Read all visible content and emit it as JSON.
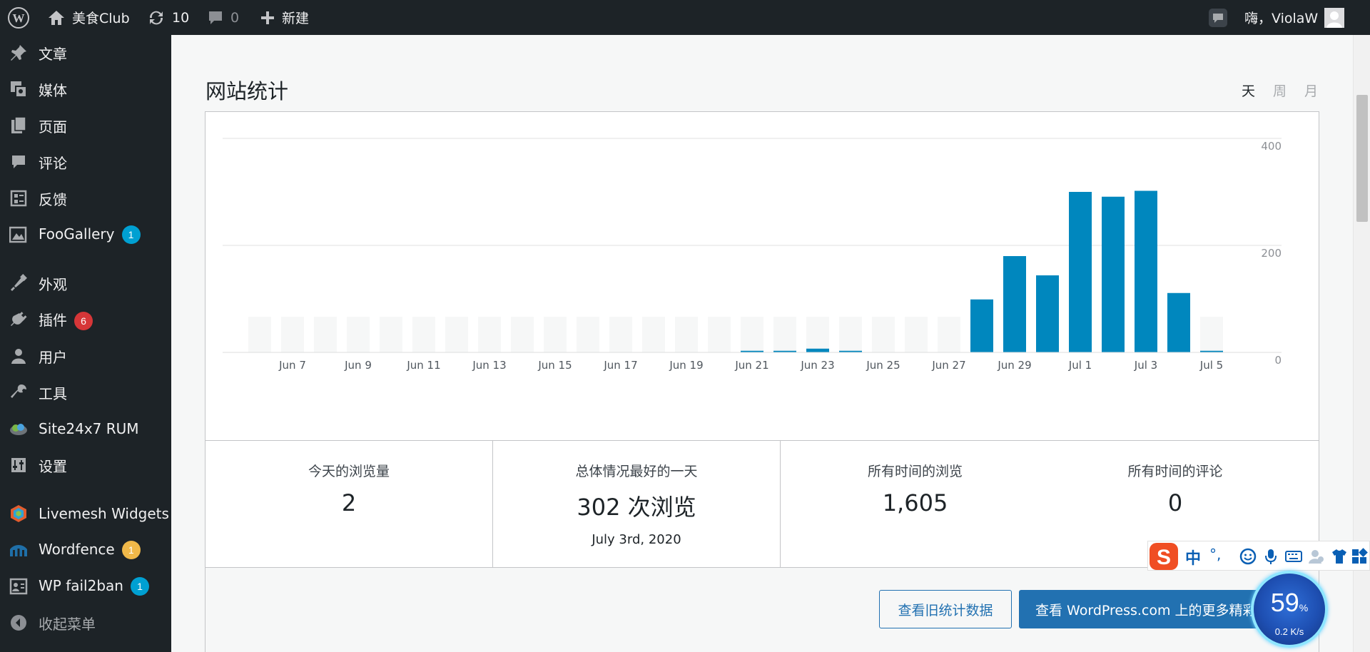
{
  "admin_bar": {
    "site_name": "美食Club",
    "updates_count": "10",
    "comments_count": "0",
    "new_label": "新建",
    "greeting": "嗨，ViolaW"
  },
  "sidebar": {
    "items": [
      {
        "label": "文章",
        "icon": "pushpin-icon"
      },
      {
        "label": "媒体",
        "icon": "media-icon"
      },
      {
        "label": "页面",
        "icon": "pages-icon"
      },
      {
        "label": "评论",
        "icon": "comment-icon"
      },
      {
        "label": "反馈",
        "icon": "feedback-icon"
      },
      {
        "label": "FooGallery",
        "icon": "gallery-icon",
        "badge": "1"
      },
      {
        "label": "外观",
        "icon": "appearance-icon"
      },
      {
        "label": "插件",
        "icon": "plugins-icon",
        "badge": "6"
      },
      {
        "label": "用户",
        "icon": "user-icon"
      },
      {
        "label": "工具",
        "icon": "tools-icon"
      },
      {
        "label": "Site24x7 RUM",
        "icon": "site24x7-icon"
      },
      {
        "label": "设置",
        "icon": "settings-icon"
      },
      {
        "label": "Livemesh Widgets",
        "icon": "livemesh-icon"
      },
      {
        "label": "Wordfence",
        "icon": "wordfence-icon",
        "badge": "1"
      },
      {
        "label": "WP fail2ban",
        "icon": "fail2ban-icon",
        "badge": "1"
      },
      {
        "label": "收起菜单",
        "icon": "collapse-icon"
      }
    ],
    "badge_colors": {
      "blue": "#00a0d2",
      "red": "#d63638",
      "orange": "#f0b849"
    }
  },
  "stats": {
    "title": "网站统计",
    "periods": [
      "天",
      "周",
      "月"
    ],
    "active_period": "天",
    "today_label": "今天的浏览量",
    "today_value": "2",
    "best_label": "总体情况最好的一天",
    "best_value": "302 次浏览",
    "best_date": "July 3rd, 2020",
    "alltime_views_label": "所有时间的浏览",
    "alltime_views_value": "1,605",
    "alltime_comments_label": "所有时间的评论",
    "alltime_comments_value": "0",
    "btn_old": "查看旧统计数据",
    "btn_more": "查看 WordPress.com 上的更多精彩"
  },
  "chart_data": {
    "type": "bar",
    "categories": [
      "Jun 6",
      "Jun 7",
      "Jun 8",
      "Jun 9",
      "Jun 10",
      "Jun 11",
      "Jun 12",
      "Jun 13",
      "Jun 14",
      "Jun 15",
      "Jun 16",
      "Jun 17",
      "Jun 18",
      "Jun 19",
      "Jun 20",
      "Jun 21",
      "Jun 22",
      "Jun 23",
      "Jun 24",
      "Jun 25",
      "Jun 26",
      "Jun 27",
      "Jun 28",
      "Jun 29",
      "Jun 30",
      "Jul 1",
      "Jul 2",
      "Jul 3",
      "Jul 4",
      "Jul 5"
    ],
    "tick_labels": [
      "Jun 7",
      "Jun 9",
      "Jun 11",
      "Jun 13",
      "Jun 15",
      "Jun 17",
      "Jun 19",
      "Jun 21",
      "Jun 23",
      "Jun 25",
      "Jun 27",
      "Jun 29",
      "Jul 1",
      "Jul 3",
      "Jul 5"
    ],
    "values": [
      0,
      0,
      0,
      0,
      0,
      0,
      0,
      0,
      0,
      0,
      0,
      0,
      0,
      0,
      0,
      3,
      3,
      7,
      3,
      0,
      0,
      0,
      99,
      180,
      144,
      300,
      291,
      302,
      111,
      3
    ],
    "ylim": [
      0,
      400
    ],
    "yticks": [
      0,
      200,
      400
    ],
    "bar_color": "#0087be",
    "empty_bar_color": "#f6f7f7",
    "grid": true
  },
  "ime": {
    "cn_label": "中",
    "punct_label": "°,"
  },
  "speed_widget": {
    "value": "59",
    "unit": "%",
    "rate": "0.2 K/s"
  }
}
